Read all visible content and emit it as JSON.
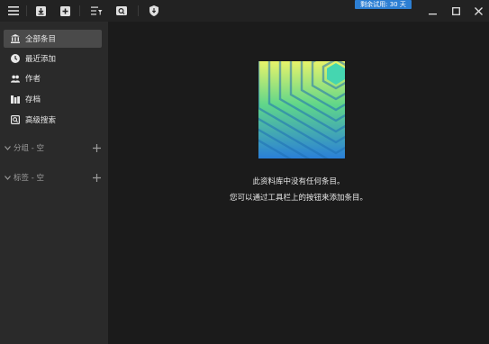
{
  "toolbar": {
    "buttons": [
      {
        "name": "menu-icon"
      },
      {
        "name": "import-icon"
      },
      {
        "name": "add-icon"
      },
      {
        "name": "list-filter-icon"
      },
      {
        "name": "scan-icon"
      },
      {
        "name": "shield-icon"
      }
    ],
    "trial_badge": "剩余试用: 30 天",
    "window": {
      "minimize": "minimize-icon",
      "maximize": "maximize-icon",
      "close": "close-icon"
    }
  },
  "sidebar": {
    "items": [
      {
        "label": "全部条目",
        "icon": "library-icon",
        "active": true
      },
      {
        "label": "最近添加",
        "icon": "clock-icon",
        "active": false
      },
      {
        "label": "作者",
        "icon": "people-icon",
        "active": false
      },
      {
        "label": "存档",
        "icon": "archive-icon",
        "active": false
      },
      {
        "label": "高级搜索",
        "icon": "advanced-search-icon",
        "active": false
      }
    ],
    "sections": [
      {
        "label": "分组 - 空"
      },
      {
        "label": "标签 - 空"
      }
    ]
  },
  "main": {
    "empty_line1": "此资料库中没有任何条目。",
    "empty_line2": "您可以通过工具栏上的按钮来添加条目。"
  },
  "colors": {
    "background": "#1b1b1b",
    "sidebar": "#2a2a2a",
    "toolbar": "#222222",
    "active_item": "#4a4a4a",
    "accent_badge": "#2d7fd3",
    "gradient_top": "#e8f36a",
    "gradient_mid": "#4fd18c",
    "gradient_bottom": "#2a7fd8"
  }
}
